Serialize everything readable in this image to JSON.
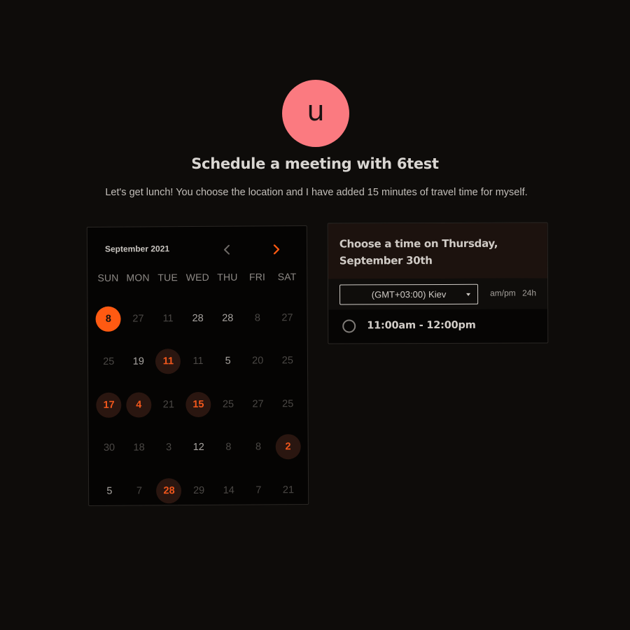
{
  "host": {
    "avatar_initial": "u",
    "avatar_color": "#fb7a80"
  },
  "title": "Schedule a meeting with 6test",
  "description": "Let's get lunch! You choose the location and I have added 15 minutes of travel time for myself.",
  "calendar": {
    "month_label": "September 2021",
    "prev_icon": "chevron-left-icon",
    "next_icon": "chevron-right-icon",
    "weekdays": [
      "SUN",
      "MON",
      "TUE",
      "WED",
      "THU",
      "FRI",
      "SAT"
    ],
    "weeks": [
      [
        {
          "d": "8",
          "s": "selected"
        },
        {
          "d": "27",
          "s": "muted"
        },
        {
          "d": "11",
          "s": "muted"
        },
        {
          "d": "28",
          "s": "normal"
        },
        {
          "d": "28",
          "s": "normal"
        },
        {
          "d": "8",
          "s": "muted"
        },
        {
          "d": "27",
          "s": "muted"
        }
      ],
      [
        {
          "d": "25",
          "s": "muted"
        },
        {
          "d": "19",
          "s": "normal"
        },
        {
          "d": "11",
          "s": "avail"
        },
        {
          "d": "11",
          "s": "muted"
        },
        {
          "d": "5",
          "s": "normal"
        },
        {
          "d": "20",
          "s": "muted"
        },
        {
          "d": "25",
          "s": "muted"
        }
      ],
      [
        {
          "d": "17",
          "s": "avail"
        },
        {
          "d": "4",
          "s": "avail"
        },
        {
          "d": "21",
          "s": "muted"
        },
        {
          "d": "15",
          "s": "avail"
        },
        {
          "d": "25",
          "s": "muted"
        },
        {
          "d": "27",
          "s": "muted"
        },
        {
          "d": "25",
          "s": "muted"
        }
      ],
      [
        {
          "d": "30",
          "s": "muted"
        },
        {
          "d": "18",
          "s": "muted"
        },
        {
          "d": "3",
          "s": "muted"
        },
        {
          "d": "12",
          "s": "normal"
        },
        {
          "d": "8",
          "s": "muted"
        },
        {
          "d": "8",
          "s": "muted"
        },
        {
          "d": "2",
          "s": "avail"
        }
      ],
      [
        {
          "d": "5",
          "s": "normal"
        },
        {
          "d": "7",
          "s": "muted"
        },
        {
          "d": "28",
          "s": "avail"
        },
        {
          "d": "29",
          "s": "muted"
        },
        {
          "d": "14",
          "s": "muted"
        },
        {
          "d": "7",
          "s": "muted"
        },
        {
          "d": "21",
          "s": "muted"
        }
      ]
    ],
    "colors": {
      "accent": "#ff5a12",
      "available_bg": "#2a1610"
    }
  },
  "times": {
    "heading": "Choose a time on Thursday, September 30th",
    "timezone": "(GMT+03:00) Kiev",
    "format_ampm": "am/pm",
    "format_24h": "24h",
    "slots": [
      "11:00am - 12:00pm"
    ]
  }
}
